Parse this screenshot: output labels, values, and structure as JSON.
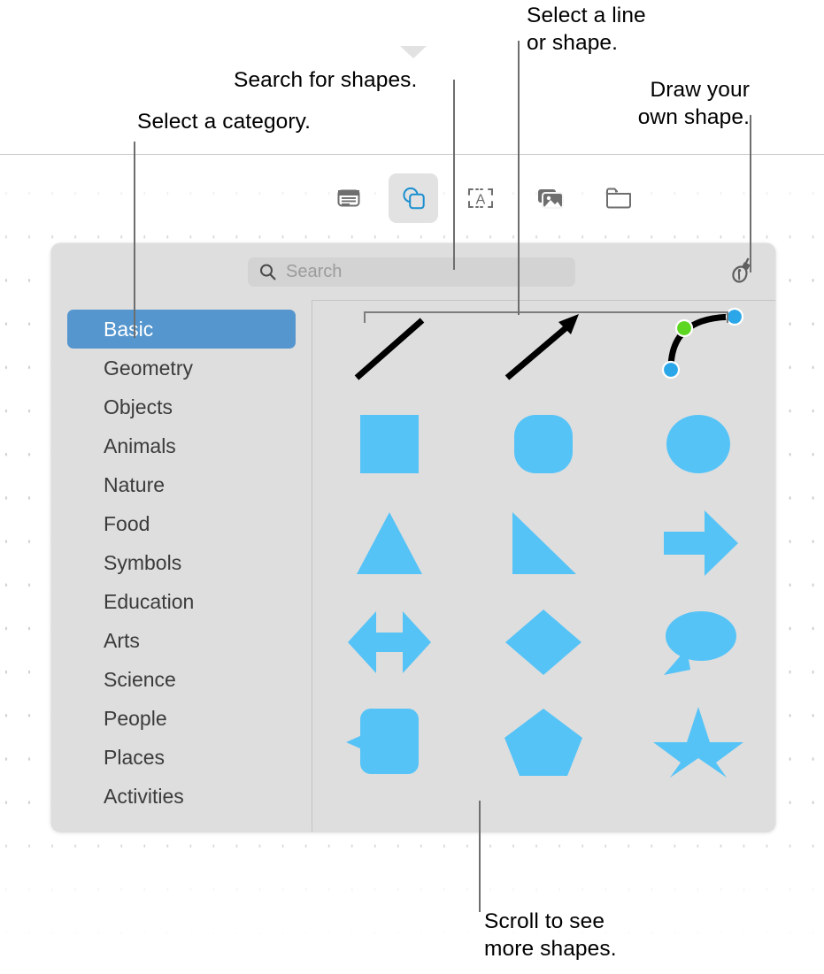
{
  "annotations": [
    {
      "id": "select-category",
      "text": "Select a category."
    },
    {
      "id": "search-for-shapes",
      "text": "Search for shapes."
    },
    {
      "id": "select-line-shape",
      "text": "Select a line\nor shape."
    },
    {
      "id": "draw-own-shape",
      "text": "Draw your\nown shape."
    },
    {
      "id": "scroll-more",
      "text": "Scroll to see\nmore shapes."
    }
  ],
  "toolbar": {
    "items": [
      {
        "name": "text-icon",
        "label": "Text",
        "selected": false
      },
      {
        "name": "shapes-icon",
        "label": "Shape",
        "selected": true
      },
      {
        "name": "textbox-icon",
        "label": "Text Box",
        "selected": false
      },
      {
        "name": "media-icon",
        "label": "Media",
        "selected": false
      },
      {
        "name": "folder-icon",
        "label": "Folder",
        "selected": false
      }
    ]
  },
  "panel": {
    "search": {
      "placeholder": "Search",
      "value": ""
    },
    "draw_button_label": "Draw with Pen",
    "categories": [
      {
        "label": "Basic",
        "selected": true
      },
      {
        "label": "Geometry",
        "selected": false
      },
      {
        "label": "Objects",
        "selected": false
      },
      {
        "label": "Animals",
        "selected": false
      },
      {
        "label": "Nature",
        "selected": false
      },
      {
        "label": "Food",
        "selected": false
      },
      {
        "label": "Symbols",
        "selected": false
      },
      {
        "label": "Education",
        "selected": false
      },
      {
        "label": "Arts",
        "selected": false
      },
      {
        "label": "Science",
        "selected": false
      },
      {
        "label": "People",
        "selected": false
      },
      {
        "label": "Places",
        "selected": false
      },
      {
        "label": "Activities",
        "selected": false
      }
    ],
    "shapes": [
      {
        "name": "line-shape",
        "label": "Line"
      },
      {
        "name": "arrow-line-shape",
        "label": "Arrow"
      },
      {
        "name": "curved-line-shape",
        "label": "Curved line"
      },
      {
        "name": "square-shape",
        "label": "Square"
      },
      {
        "name": "rounded-square-shape",
        "label": "Rounded square"
      },
      {
        "name": "circle-shape",
        "label": "Circle"
      },
      {
        "name": "triangle-shape",
        "label": "Triangle"
      },
      {
        "name": "right-triangle-shape",
        "label": "Right triangle"
      },
      {
        "name": "right-arrow-shape",
        "label": "Right arrow"
      },
      {
        "name": "double-arrow-shape",
        "label": "Double arrow"
      },
      {
        "name": "diamond-shape",
        "label": "Diamond"
      },
      {
        "name": "speech-bubble-shape",
        "label": "Speech bubble"
      },
      {
        "name": "rounded-callout-shape",
        "label": "Rounded callout"
      },
      {
        "name": "pentagon-shape",
        "label": "Pentagon"
      },
      {
        "name": "star-shape",
        "label": "Star"
      }
    ]
  },
  "colors": {
    "shape_blue": "#56c3f7",
    "selection_blue": "#5596ce",
    "handle_blue": "#2ba6e8",
    "handle_green": "#5cd620",
    "panel_gray": "#dedede",
    "toolbar_selected_gray": "#e2e2e2"
  }
}
